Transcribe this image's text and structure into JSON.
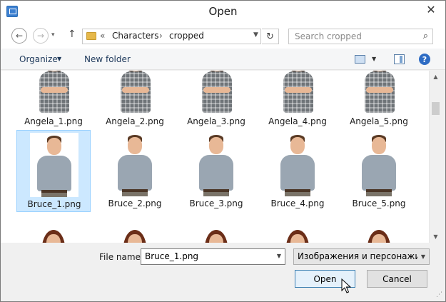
{
  "window": {
    "title": "Open"
  },
  "nav": {
    "back_glyph": "←",
    "forward_glyph": "→",
    "recent_glyph": "▾",
    "up_glyph": "↑",
    "breadcrumb_prefix": "«",
    "breadcrumbs": [
      "Characters",
      "cropped"
    ],
    "crumb_separator": "›",
    "refresh_glyph": "↻",
    "search_placeholder": "Search cropped"
  },
  "toolbar": {
    "organize_label": "Organize",
    "new_folder_label": "New folder"
  },
  "icons": {
    "app": "dialog-app-icon",
    "close": "close-icon",
    "folder": "folder-icon",
    "search": "search-icon",
    "view": "change-view-icon",
    "preview_pane": "preview-pane-icon",
    "help": "help-icon",
    "cursor": "mouse-cursor-icon"
  },
  "files": [
    {
      "name": "Angela_1.png",
      "person": "angela"
    },
    {
      "name": "Angela_2.png",
      "person": "angela"
    },
    {
      "name": "Angela_3.png",
      "person": "angela"
    },
    {
      "name": "Angela_4.png",
      "person": "angela"
    },
    {
      "name": "Angela_5.png",
      "person": "angela"
    },
    {
      "name": "Bruce_1.png",
      "person": "bruce",
      "selected": true
    },
    {
      "name": "Bruce_2.png",
      "person": "bruce"
    },
    {
      "name": "Bruce_3.png",
      "person": "bruce"
    },
    {
      "name": "Bruce_4.png",
      "person": "bruce"
    },
    {
      "name": "Bruce_5.png",
      "person": "bruce"
    },
    {
      "name": "",
      "person": "woman"
    },
    {
      "name": "",
      "person": "woman"
    },
    {
      "name": "",
      "person": "woman"
    },
    {
      "name": "",
      "person": "woman"
    },
    {
      "name": "",
      "person": "woman"
    }
  ],
  "bottom": {
    "file_name_label": "File name:",
    "file_name_value": "Bruce_1.png",
    "file_type_value": "Изображения и персонажи Ta",
    "open_label": "Open",
    "cancel_label": "Cancel"
  },
  "colors": {
    "selection_fill": "#cce8ff",
    "selection_border": "#99d1ff",
    "open_button_border": "#3c7fb1"
  }
}
